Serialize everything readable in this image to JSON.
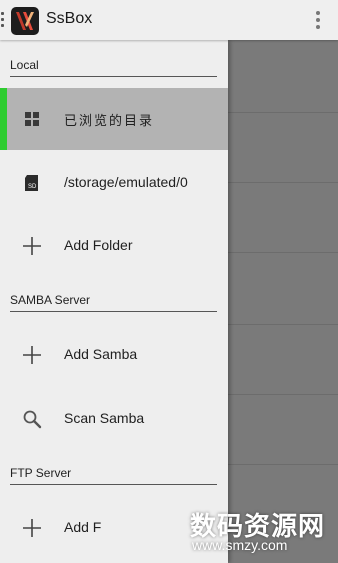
{
  "app": {
    "title": "SsBox"
  },
  "drawer": {
    "sections": [
      {
        "header": "Local",
        "items": [
          {
            "label": "已浏览的目录",
            "icon": "grid-icon",
            "selected": true
          },
          {
            "label": "/storage/emulated/0",
            "icon": "sd-card-icon",
            "sd_text": "SD"
          },
          {
            "label": "Add Folder",
            "icon": "plus-icon"
          }
        ]
      },
      {
        "header": "SAMBA Server",
        "items": [
          {
            "label": "Add Samba",
            "icon": "plus-icon"
          },
          {
            "label": "Scan Samba",
            "icon": "search-icon"
          }
        ]
      },
      {
        "header": "FTP Server",
        "items": [
          {
            "label": "Add F",
            "icon": "plus-icon"
          }
        ]
      }
    ]
  },
  "watermark": {
    "text": "数码资源网",
    "url": "www.smzy.com"
  },
  "colors": {
    "accent": "#2ecc30",
    "selected_bg": "#b3b3b3",
    "drawer_bg": "#eeeeee",
    "content_bg": "#7a7a7a"
  }
}
